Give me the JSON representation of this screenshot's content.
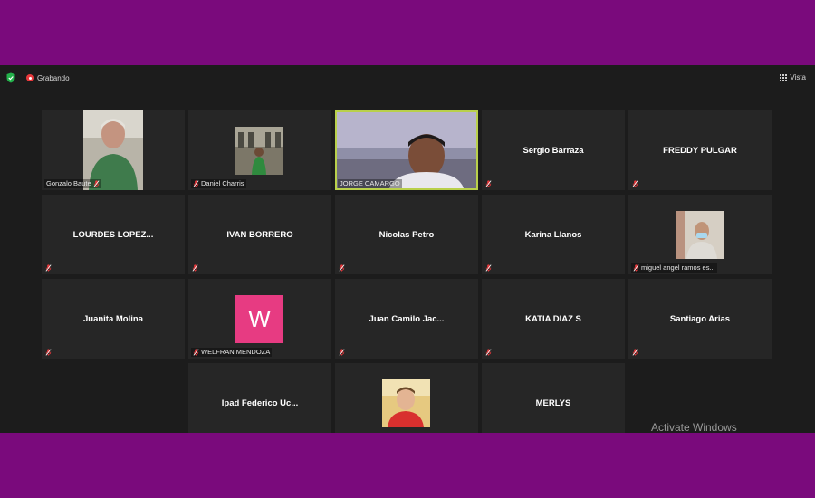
{
  "topbar": {
    "recording_label": "Grabando",
    "view_label": "Vista"
  },
  "participants": [
    {
      "name": "Gonzalo Baute",
      "video": true
    },
    {
      "name": "Daniel Charris",
      "video": true
    },
    {
      "name": "JORGE CAMARGO",
      "video": true,
      "active_speaker": true
    },
    {
      "name": "Sergio Barraza",
      "video": false
    },
    {
      "name": "FREDDY PULGAR",
      "video": false
    },
    {
      "name": "LOURDES  LOPEZ...",
      "video": false
    },
    {
      "name": "IVAN BORRERO",
      "video": false
    },
    {
      "name": "Nicolas Petro",
      "video": false
    },
    {
      "name": "Karina Llanos",
      "video": false
    },
    {
      "name": "miguel angel ramos es...",
      "video": true
    },
    {
      "name": "Juanita Molina",
      "video": false
    },
    {
      "name": "WELFRAN MENDOZA",
      "video": false,
      "avatar_letter": "W"
    },
    {
      "name": "Juan Camilo Jac...",
      "video": false
    },
    {
      "name": "KATIA DIAZ S",
      "video": false
    },
    {
      "name": "Santiago Arias",
      "video": false
    },
    {
      "name": "Ipad Federico Uc...",
      "video": false
    },
    {
      "name": "",
      "video": true
    },
    {
      "name": "MERLYS",
      "video": false
    }
  ],
  "watermark": "Activate Windows",
  "colors": {
    "border_background": "#7a0a7c",
    "app_background": "#1c1c1c",
    "tile_background": "#262626",
    "active_speaker_border": "#b9d04b",
    "muted_icon": "#e8383b",
    "avatar_tile": "#e73b82"
  }
}
